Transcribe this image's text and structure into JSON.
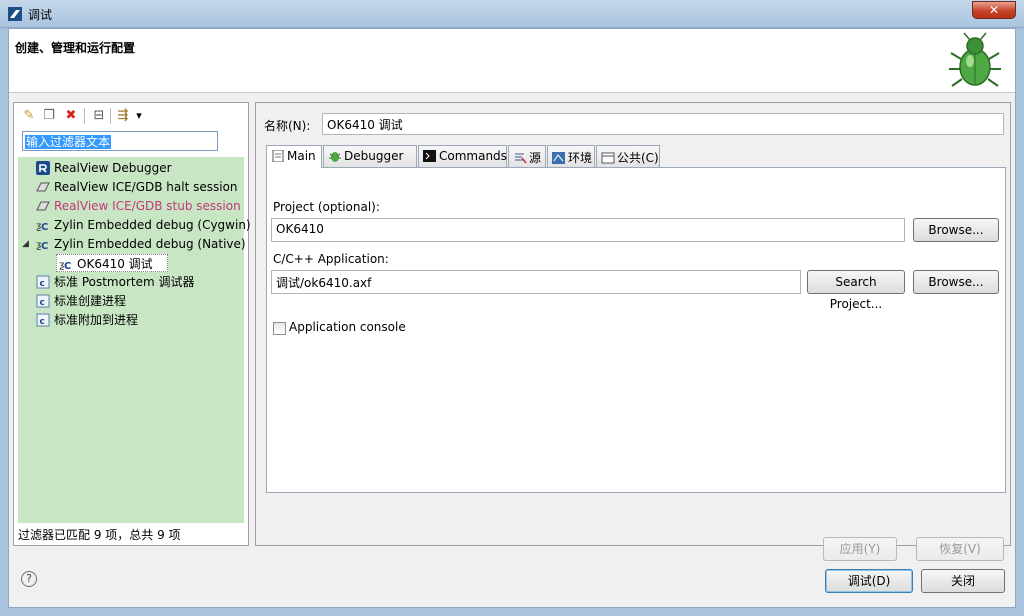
{
  "window": {
    "title": "调试",
    "close_glyph": "✕",
    "banner_title": "创建、管理和运行配置",
    "banner_icon": "bug-icon"
  },
  "left": {
    "toolbar": [
      {
        "name": "new-config-icon",
        "glyph": "✎"
      },
      {
        "name": "duplicate-icon",
        "glyph": "❐"
      },
      {
        "name": "delete-icon",
        "glyph": "✖"
      },
      {
        "name": "collapse-all-icon",
        "glyph": "⊟"
      },
      {
        "name": "filter-icon",
        "glyph": "⇶"
      },
      {
        "name": "dropdown-icon",
        "glyph": "▾"
      }
    ],
    "filter_text": "输入过滤器文本",
    "tree": [
      {
        "label": "RealView Debugger",
        "icon": "realview-debugger-icon"
      },
      {
        "label": "RealView ICE/GDB halt session",
        "icon": "gdb-session-icon"
      },
      {
        "label": "RealView ICE/GDB stub session",
        "icon": "gdb-session-icon"
      },
      {
        "label": "Zylin Embedded debug (Cygwin)",
        "icon": "c-debug-icon"
      },
      {
        "label": "Zylin Embedded debug (Native)",
        "icon": "c-debug-icon",
        "expanded": "◢"
      },
      {
        "label": "OK6410 调试",
        "icon": "c-debug-icon"
      },
      {
        "label": "标准 Postmortem 调试器",
        "icon": "c-app-icon"
      },
      {
        "label": "标准创建进程",
        "icon": "c-app-icon"
      },
      {
        "label": "标准附加到进程",
        "icon": "c-app-icon"
      }
    ],
    "status": "过滤器已匹配 9 项，总共 9 项"
  },
  "right": {
    "name_label": "名称(N):",
    "name_value": "OK6410 调试",
    "tabs": [
      {
        "label": "Main",
        "icon": "main-tab-icon"
      },
      {
        "label": "Debugger",
        "icon": "debugger-tab-icon"
      },
      {
        "label": "Commands",
        "icon": "commands-tab-icon"
      },
      {
        "label": "源",
        "icon": "source-tab-icon"
      },
      {
        "label": "环境",
        "icon": "environment-tab-icon"
      },
      {
        "label": "公共(C)",
        "icon": "common-tab-icon"
      }
    ],
    "project_label": "Project (optional):",
    "project_value": "OK6410",
    "browse_label": "Browse...",
    "app_label": "C/C++ Application:",
    "app_value": "调试/ok6410.axf",
    "search_project_label": "Search Project...",
    "console_label": "Application console",
    "apply_label": "应用(Y)",
    "revert_label": "恢复(V)"
  },
  "footer": {
    "help_glyph": "?",
    "debug_label": "调试(D)",
    "close_label": "关闭"
  },
  "colors": {
    "tree_bg": "#c9e6c4",
    "accent": "#3399ff",
    "stub_session_text": "#c0397a"
  }
}
